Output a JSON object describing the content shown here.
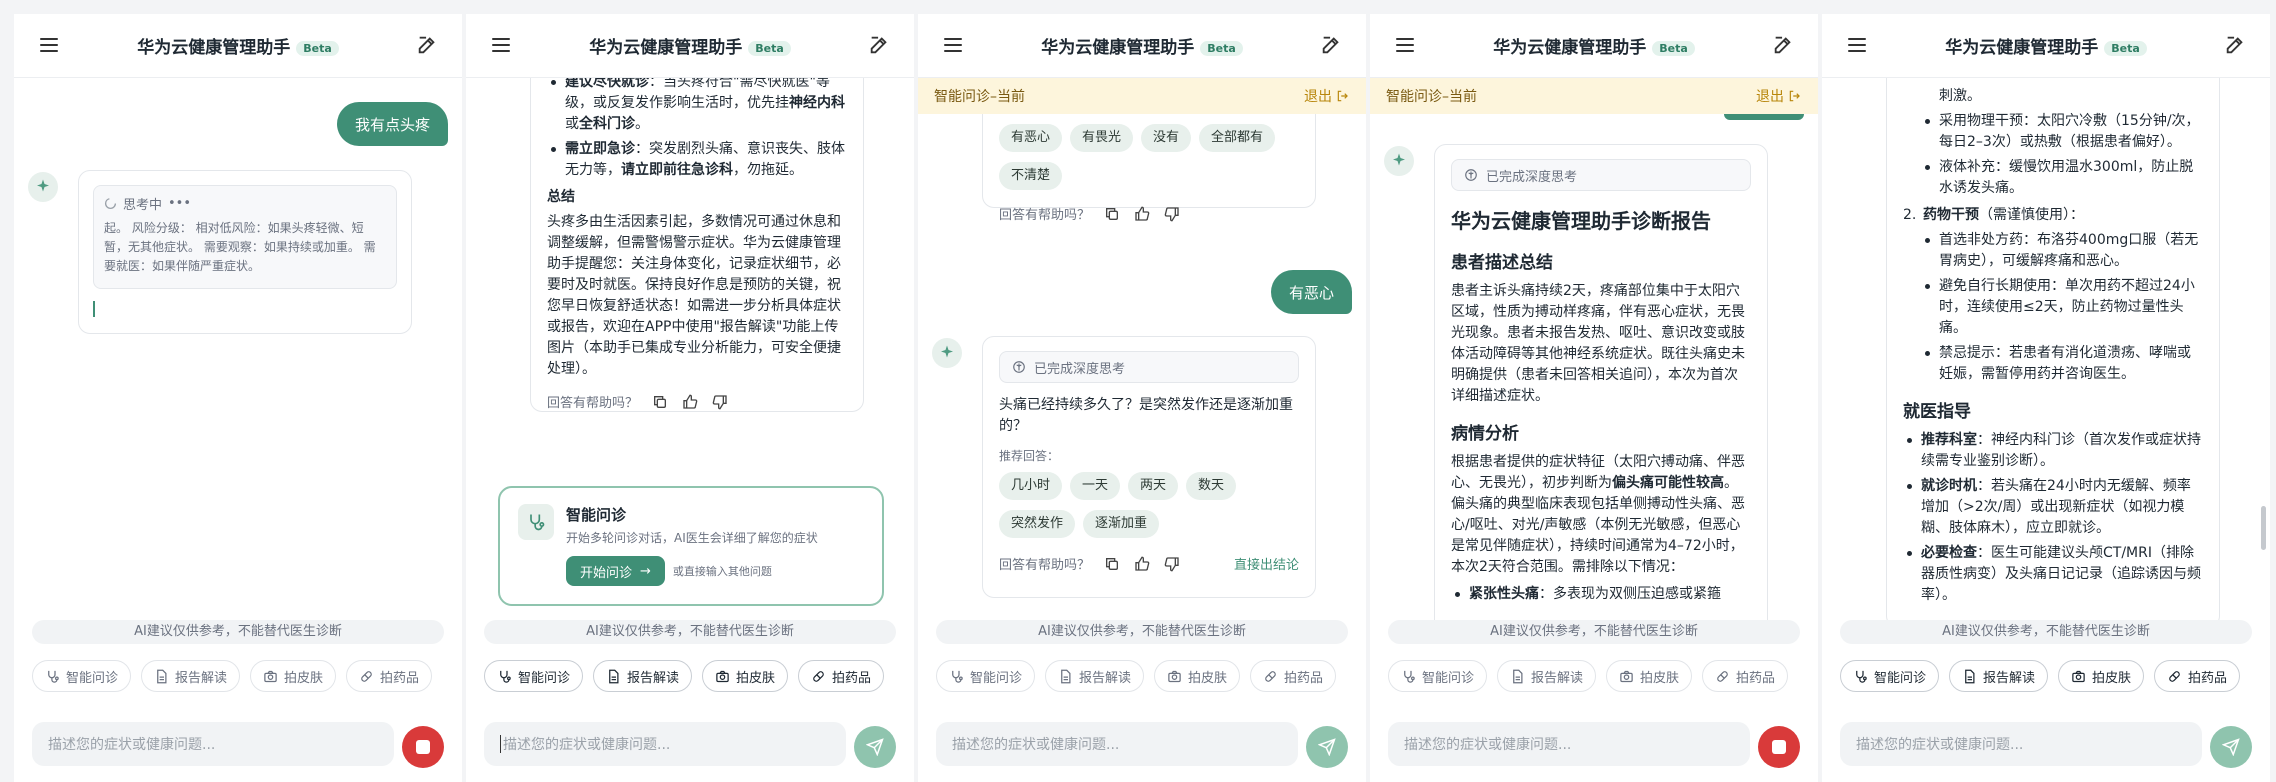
{
  "app": {
    "title": "华为云健康管理助手",
    "beta": "Beta"
  },
  "common": {
    "disclaimer": "AI建议仅供参考，不能替代医生诊断",
    "input_placeholder": "描述您的症状或健康问题...",
    "tools": [
      {
        "icon": "stethoscope-icon",
        "label": "智能问诊"
      },
      {
        "icon": "document-icon",
        "label": "报告解读"
      },
      {
        "icon": "camera-icon",
        "label": "拍皮肤"
      },
      {
        "icon": "pill-icon",
        "label": "拍药品"
      }
    ],
    "feedback": "回答有帮助吗？"
  },
  "banner": {
    "label": "智能问诊–当前",
    "exit": "退出"
  },
  "panel1": {
    "user_msg": "我有点头疼",
    "thinking": {
      "label": "思考中",
      "dots": "•••",
      "text": "起。 风险分级： 相对低风险：如果头疼轻微、短暂，无其他症状。 需要观察：如果持续或加重。 需要就医：如果伴随严重症状。"
    }
  },
  "panel2": {
    "top_bullets": [
      {
        "bold_a": "建议尽快就诊",
        "text_a": "：当头疼符合\"需尽快就医\"等级，或反复发作影响生活时，优先挂",
        "bold_b": "神经内科",
        "text_b": "或",
        "bold_c": "全科门诊",
        "text_c": "。"
      },
      {
        "bold_a": "需立即急诊",
        "text_a": "：突发剧烈头痛、意识丧失、肢体无力等，",
        "bold_b": "请立即前往急诊科",
        "text_b": "，勿拖延。",
        "bold_c": "",
        "text_c": ""
      }
    ],
    "summary_title": "总结",
    "summary": "头疼多由生活因素引起，多数情况可通过休息和调整缓解，但需警惕警示症状。华为云健康管理助手提醒您：关注身体变化，记录症状细节，必要时及时就医。保持良好作息是预防的关键，祝您早日恢复舒适状态！如需进一步分析具体症状或报告，欢迎在APP中使用\"报告解读\"功能上传图片（本助手已集成专业分析能力，可安全便捷处理）。",
    "consult_card": {
      "title": "智能问诊",
      "desc": "开始多轮问诊对话，AI医生会详细了解您的症状",
      "button": "开始问诊",
      "hint": "或直接输入其他问题"
    }
  },
  "panel3": {
    "options_top": [
      "有恶心",
      "有畏光",
      "没有",
      "全部都有",
      "不清楚"
    ],
    "user_msg": "有恶心",
    "thinking_done": "已完成深度思考",
    "question": "头痛已经持续多久了？是突然发作还是逐渐加重的？",
    "suggest_label": "推荐回答：",
    "options": [
      "几小时",
      "一天",
      "两天",
      "数天",
      "突然发作",
      "逐渐加重"
    ],
    "direct_link": "直接出结论"
  },
  "panel4": {
    "thinking_done": "已完成深度思考",
    "report_title": "华为云健康管理助手诊断报告",
    "sec1": "患者描述总结",
    "sec1_text": "患者主诉头痛持续2天，疼痛部位集中于太阳穴区域，性质为搏动样疼痛，伴有恶心症状，无畏光现象。患者未报告发热、呕吐、意识改变或肢体活动障碍等其他神经系统症状。既往头痛史未明确提供（患者未回答相关追问），本次为首次详细描述症状。",
    "sec2": "病情分析",
    "sec2_text_a": "根据患者提供的症状特征（太阳穴搏动痛、伴恶心、无畏光），初步判断为",
    "sec2_bold": "偏头痛可能性较高",
    "sec2_text_b": "。偏头痛的典型临床表现包括单侧搏动性头痛、恶心/呕吐、对光/声敏感（本例无光敏感，但恶心是常见伴随症状），持续时间通常为4–72小时，本次2天符合范围。需排除以下情况：",
    "bullet_bold": "紧张性头痛",
    "bullet_text": "：多表现为双侧压迫感或紧箍"
  },
  "panel5": {
    "top_fragment": "刺激。",
    "physical": [
      "采用物理干预：太阳穴冷敷（15分钟/次，每日2–3次）或热敷（根据患者偏好）。",
      "液体补充：缓慢饮用温水300ml，防止脱水诱发头痛。"
    ],
    "drug_num": "2.",
    "drug_title": "药物干预",
    "drug_note": "（需谨慎使用）：",
    "drugs": [
      "首选非处方药：布洛芬400mg口服（若无胃病史），可缓解疼痛和恶心。",
      "避免自行长期使用：单次用药不超过24小时，连续使用≤2天，防止药物过量性头痛。",
      "禁忌提示：若患者有消化道溃疡、哮喘或妊娠，需暂停用药并咨询医生。"
    ],
    "guide_title": "就医指导",
    "guides": [
      {
        "bold": "推荐科室",
        "text": "：神经内科门诊（首次发作或症状持续需专业鉴别诊断）。"
      },
      {
        "bold": "就诊时机",
        "text": "：若头痛在24小时内无缓解、频率增加（>2次/周）或出现新症状（如视力模糊、肢体麻木），应立即就诊。"
      },
      {
        "bold": "必要检查",
        "text": "：医生可能建议头颅CT/MRI（排除器质性病变）及头痛日记记录（追踪诱因与频率）。"
      }
    ]
  }
}
